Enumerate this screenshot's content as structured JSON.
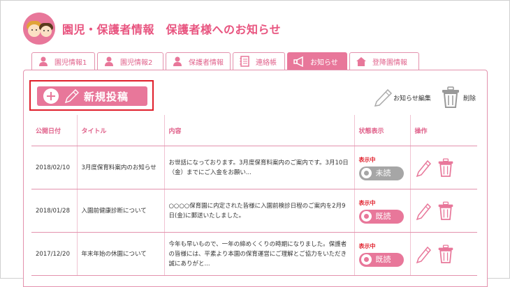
{
  "header": {
    "title": "園児・保護者情報　保護者様へのお知らせ"
  },
  "tabs": [
    {
      "label": "園児情報1",
      "icon": "person-icon"
    },
    {
      "label": "園児情報2",
      "icon": "person-icon"
    },
    {
      "label": "保護者情報",
      "icon": "person-icon"
    },
    {
      "label": "連絡帳",
      "icon": "notebook-icon"
    },
    {
      "label": "お知らせ",
      "icon": "megaphone-icon",
      "active": true
    },
    {
      "label": "登降園情報",
      "icon": "house-icon"
    }
  ],
  "toolbar": {
    "new_post_label": "新規投稿",
    "edit_label": "お知らせ編集",
    "delete_label": "削除"
  },
  "table": {
    "headers": [
      "公開日付",
      "タイトル",
      "内容",
      "状態表示",
      "操作"
    ],
    "rows": [
      {
        "date": "2018/02/10",
        "title": "3月度保育料案内のお知らせ",
        "content": "お世話になっております。3月度保育料案内のご案内です。3月10日（金）までにご入金をお願い...",
        "status": "表示中",
        "read": "未読",
        "read_state": "unread"
      },
      {
        "date": "2018/01/28",
        "title": "入園前健康診断について",
        "content": "○○○○保育園に内定された皆様に入園前検診日程のご案内を2月9日(金)に郵送いたしました。",
        "status": "表示中",
        "read": "既読",
        "read_state": "done"
      },
      {
        "date": "2017/12/20",
        "title": "年末年始の休園について",
        "content": "今年も早いもので、一年の締めくくりの時期になりました。保護者の皆様には、平素より本園の保育運営にご理解とご協力をいただき誠にありがと...",
        "status": "表示中",
        "read": "既読",
        "read_state": "done"
      }
    ]
  },
  "colors": {
    "accent": "#e8779a",
    "text_accent": "#e0628b",
    "highlight_border": "#e01e2a",
    "unread": "#a6a6a6"
  }
}
